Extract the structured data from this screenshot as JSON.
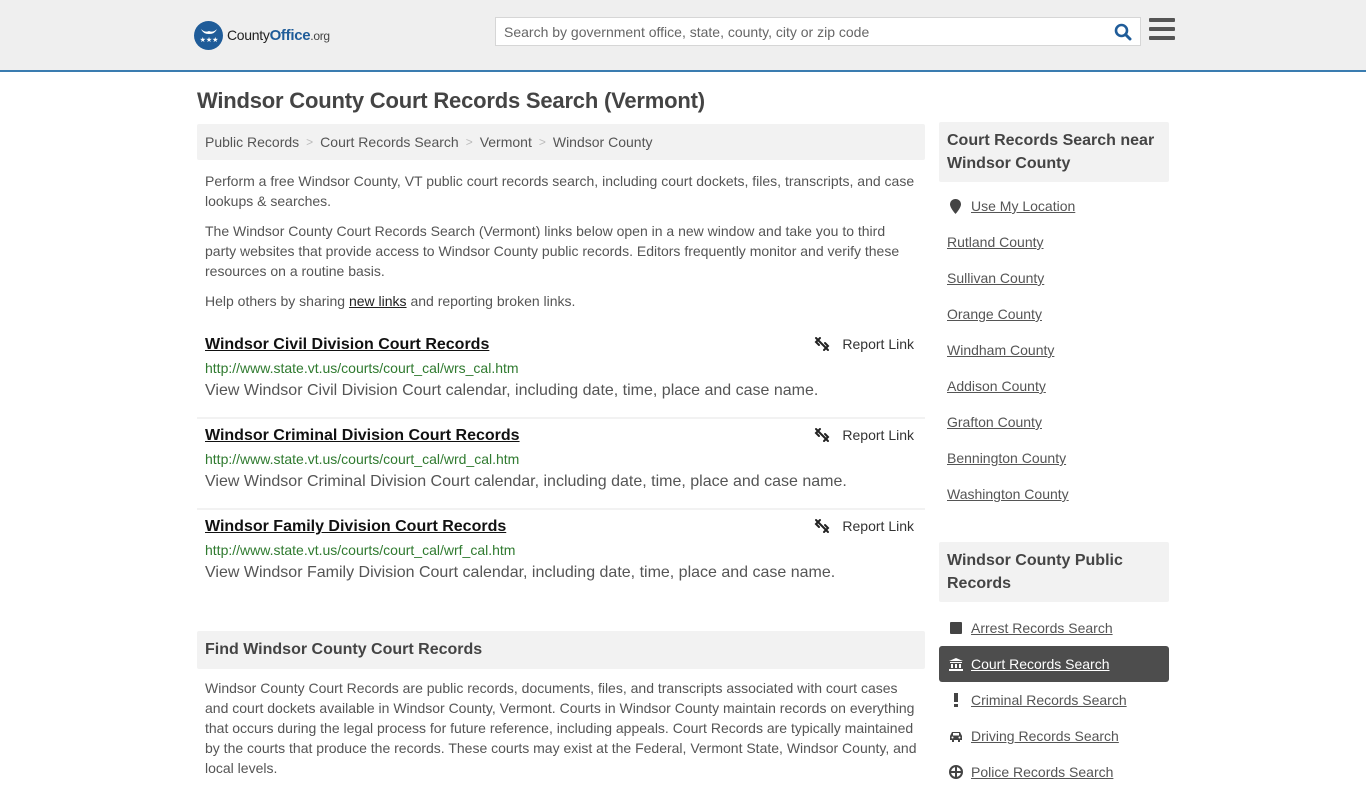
{
  "header": {
    "logo": {
      "county": "County",
      "office": "Office",
      "org": ".org"
    },
    "search_placeholder": "Search by government office, state, county, city or zip code",
    "search_value": "",
    "brand_color": "#1f5c99",
    "accent_color": "#3a7cb0"
  },
  "page_title": "Windsor County Court Records Search (Vermont)",
  "breadcrumb": [
    {
      "label": "Public Records"
    },
    {
      "label": "Court Records Search"
    },
    {
      "label": "Vermont"
    },
    {
      "label": "Windsor County"
    }
  ],
  "intro": {
    "p1": "Perform a free Windsor County, VT public court records search, including court dockets, files, transcripts, and case lookups & searches.",
    "p2": "The Windsor County Court Records Search (Vermont) links below open in a new window and take you to third party websites that provide access to Windsor County public records. Editors frequently monitor and verify these resources on a routine basis.",
    "p3_before": "Help others by sharing ",
    "p3_link": "new links",
    "p3_after": " and reporting broken links."
  },
  "records": [
    {
      "title": "Windsor Civil Division Court Records",
      "url": "http://www.state.vt.us/courts/court_cal/wrs_cal.htm",
      "description": "View Windsor Civil Division Court calendar, including date, time, place and case name.",
      "report_label": "Report Link"
    },
    {
      "title": "Windsor Criminal Division Court Records",
      "url": "http://www.state.vt.us/courts/court_cal/wrd_cal.htm",
      "description": "View Windsor Criminal Division Court calendar, including date, time, place and case name.",
      "report_label": "Report Link"
    },
    {
      "title": "Windsor Family Division Court Records",
      "url": "http://www.state.vt.us/courts/court_cal/wrf_cal.htm",
      "description": "View Windsor Family Division Court calendar, including date, time, place and case name.",
      "report_label": "Report Link"
    }
  ],
  "find": {
    "heading": "Find Windsor County Court Records",
    "body": "Windsor County Court Records are public records, documents, files, and transcripts associated with court cases and court dockets available in Windsor County, Vermont. Courts in Windsor County maintain records on everything that occurs during the legal process for future reference, including appeals. Court Records are typically maintained by the courts that produce the records. These courts may exist at the Federal, Vermont State, Windsor County, and local levels."
  },
  "sidebar": {
    "nearby_heading": "Court Records Search near Windsor County",
    "use_location": "Use My Location",
    "nearby": [
      "Rutland County",
      "Sullivan County",
      "Orange County",
      "Windham County",
      "Addison County",
      "Grafton County",
      "Bennington County",
      "Washington County"
    ],
    "public_heading": "Windsor County Public Records",
    "public_records": [
      {
        "label": "Arrest Records Search",
        "icon": "square-icon",
        "active": false
      },
      {
        "label": "Court Records Search",
        "icon": "courthouse-icon",
        "active": true
      },
      {
        "label": "Criminal Records Search",
        "icon": "exclamation-icon",
        "active": false
      },
      {
        "label": "Driving Records Search",
        "icon": "car-icon",
        "active": false
      },
      {
        "label": "Police Records Search",
        "icon": "police-badge-icon",
        "active": false
      }
    ]
  }
}
